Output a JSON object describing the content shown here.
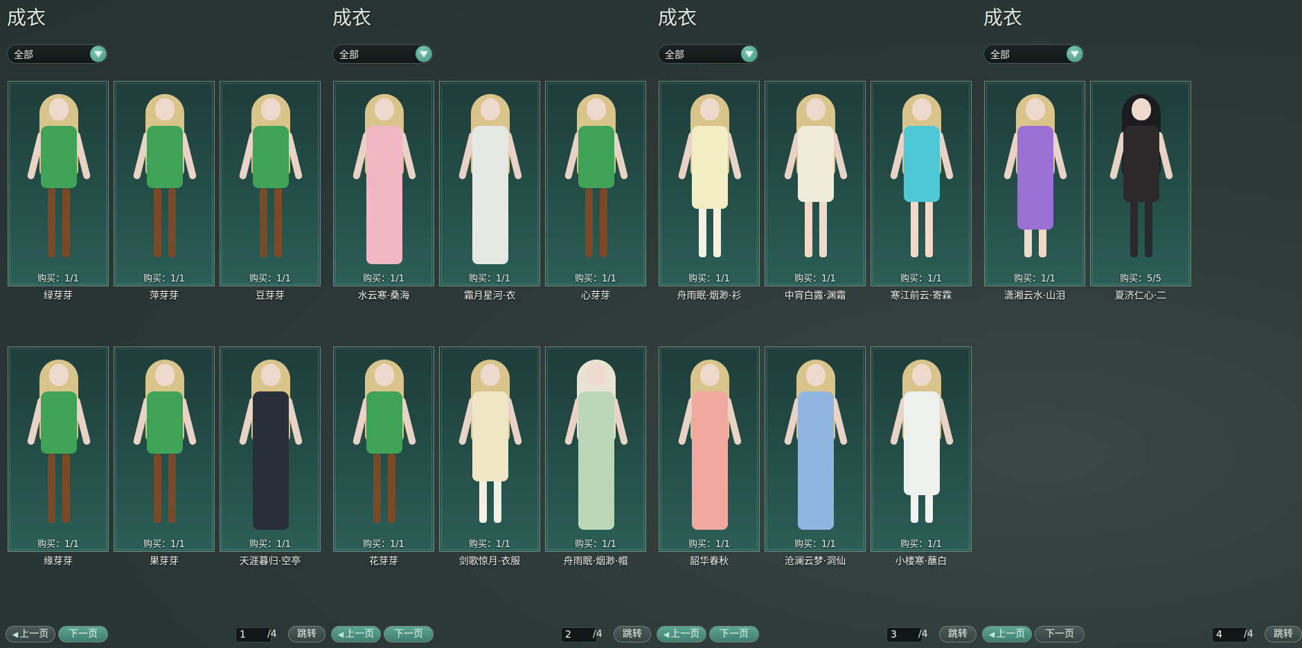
{
  "panels": [
    {
      "title": "成衣",
      "filter": "全部",
      "items": [
        {
          "name": "绿芽芽",
          "buy": "购买：1/1"
        },
        {
          "name": "萍芽芽",
          "buy": "购买：1/1"
        },
        {
          "name": "豆芽芽",
          "buy": "购买：1/1"
        },
        {
          "name": "缘芽芽",
          "buy": "购买：1/1"
        },
        {
          "name": "果芽芽",
          "buy": "购买：1/1"
        },
        {
          "name": "天涯暮归·空亭",
          "buy": "购买：1/1"
        }
      ],
      "pager": {
        "prev": "上一页",
        "next": "下一页",
        "page": "1",
        "total": "/4",
        "jump": "跳转"
      }
    },
    {
      "title": "成衣",
      "filter": "全部",
      "items": [
        {
          "name": "水云寒·桑海",
          "buy": "购买：1/1"
        },
        {
          "name": "霜月星河·衣",
          "buy": "购买：1/1"
        },
        {
          "name": "心芽芽",
          "buy": "购买：1/1"
        },
        {
          "name": "花芽芽",
          "buy": "购买：1/1"
        },
        {
          "name": "剑歌惊月·衣服",
          "buy": "购买：1/1"
        },
        {
          "name": "舟雨眠·烟渺·帽",
          "buy": "购买：1/1"
        }
      ],
      "pager": {
        "prev": "上一页",
        "next": "下一页",
        "page": "2",
        "total": "/4",
        "jump": "跳转"
      }
    },
    {
      "title": "成衣",
      "filter": "全部",
      "items": [
        {
          "name": "舟雨眠·烟渺·衫",
          "buy": "购买：1/1"
        },
        {
          "name": "中宵白露·渊霜",
          "buy": "购买：1/1"
        },
        {
          "name": "寒江前云·寄霖",
          "buy": "购买：1/1"
        },
        {
          "name": "韶华春秋",
          "buy": "购买：1/1"
        },
        {
          "name": "沧澜云梦·洞仙",
          "buy": "购买：1/1"
        },
        {
          "name": "小楼寒·蘸白",
          "buy": "购买：1/1"
        }
      ],
      "pager": {
        "prev": "上一页",
        "next": "下一页",
        "page": "3",
        "total": "/4",
        "jump": "跳转"
      }
    },
    {
      "title": "成衣",
      "filter": "全部",
      "items": [
        {
          "name": "潇湘云水·山泪",
          "buy": "购买：1/1"
        },
        {
          "name": "夏济仁心·二",
          "buy": "购买：5/5"
        }
      ],
      "pager": {
        "prev": "上一页",
        "next": "下一页",
        "page": "4",
        "total": "/4",
        "jump": "跳转"
      }
    }
  ],
  "colors": {
    "panel_bg": "#2d3837",
    "card_bg": "#25504a",
    "accent": "#4f9a86"
  }
}
